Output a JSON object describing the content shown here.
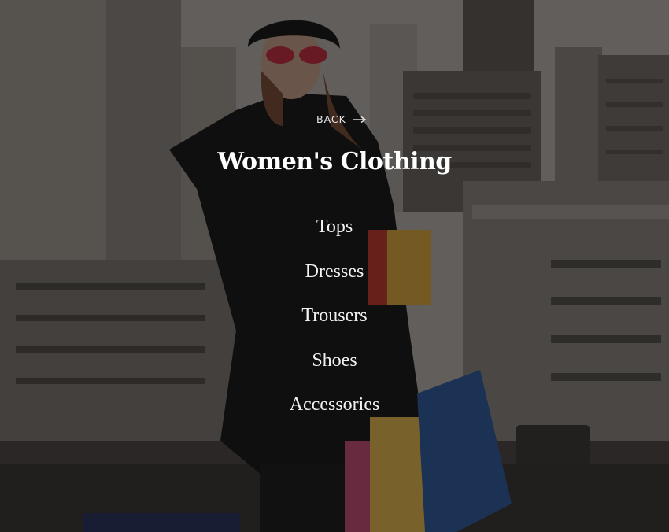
{
  "menu": {
    "back_label": "BACK",
    "title": "Women's Clothing",
    "items": [
      {
        "label": "Tops"
      },
      {
        "label": "Dresses"
      },
      {
        "label": "Trousers"
      },
      {
        "label": "Shoes"
      },
      {
        "label": "Accessories"
      }
    ]
  },
  "icons": {
    "back": "arrow-right-icon"
  },
  "colors": {
    "text": "#ffffff",
    "overlay": "rgba(10,10,10,0.50)"
  }
}
